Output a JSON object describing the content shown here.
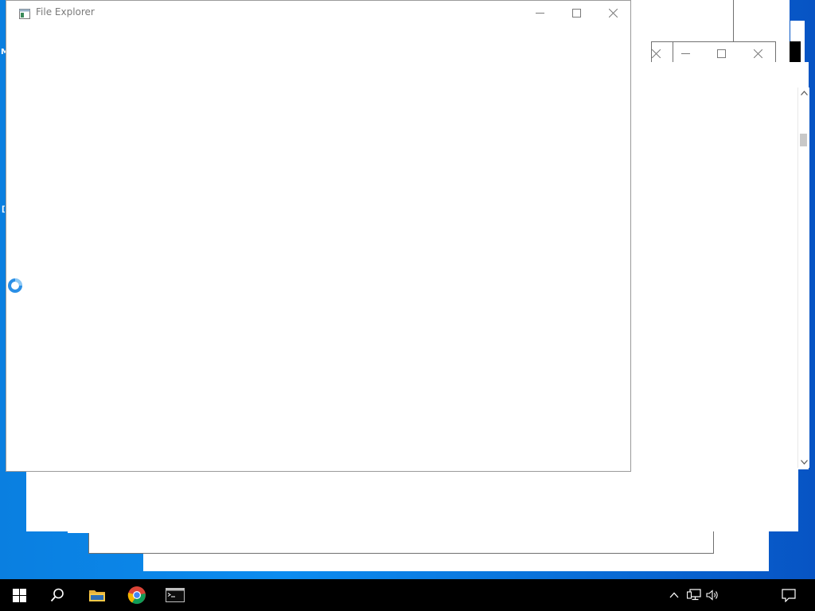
{
  "desktop": {
    "background": "#0a7fe0"
  },
  "windows": {
    "front": {
      "title": "File Explorer",
      "icon": "app-window-icon",
      "controls": [
        "minimize-icon",
        "maximize-icon",
        "close-icon"
      ]
    },
    "behind": {
      "controls": [
        "close-icon",
        "minimize-icon",
        "maximize-icon",
        "close-icon"
      ]
    }
  },
  "cursor": {
    "state": "busy",
    "icon": "busy-cursor-icon"
  },
  "taskbar": {
    "items": [
      {
        "name": "start-button",
        "icon": "windows-logo-icon"
      },
      {
        "name": "search-button",
        "icon": "search-icon"
      },
      {
        "name": "file-explorer-taskbar-button",
        "icon": "folder-icon"
      },
      {
        "name": "chrome-taskbar-button",
        "icon": "chrome-icon"
      },
      {
        "name": "terminal-taskbar-button",
        "icon": "terminal-icon"
      }
    ],
    "tray": [
      "chevron-up-icon",
      "network-icon",
      "volume-icon",
      "notification-icon"
    ]
  },
  "colors": {
    "taskbar": "#000000",
    "accent": "#0a7fe0",
    "window_border": "#707070"
  }
}
